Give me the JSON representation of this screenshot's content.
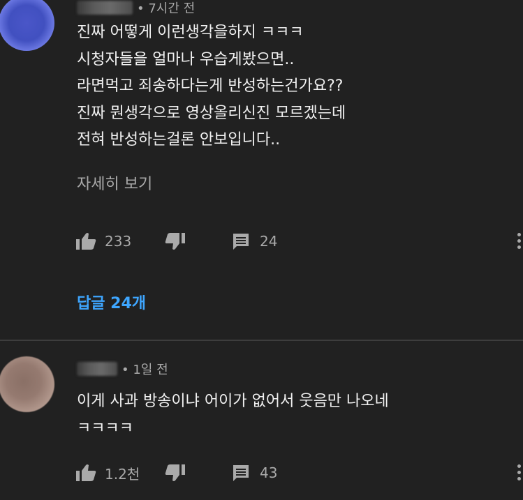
{
  "colors": {
    "background": "#212121",
    "text_primary": "#f1f1f1",
    "text_secondary": "#aaaaaa",
    "link_blue": "#3ea6ff",
    "divider": "#3d3d3d"
  },
  "comments": [
    {
      "time": "• 7시간 전",
      "lines": [
        "진짜 어떻게 이런생각을하지 ㅋㅋㅋ",
        "시청자들을 얼마나 우습게봤으면..",
        "라면먹고 죄송하다는게 반성하는건가요??",
        "진짜 뭔생각으로 영상올리신진 모르겠는데",
        "전혀 반성하는걸론 안보입니다.."
      ],
      "read_more": "자세히 보기",
      "likes": "233",
      "replies_count": "24",
      "replies_link": "답글 24개",
      "icons": {
        "like": "thumb-up-icon",
        "dislike": "thumb-down-icon",
        "reply": "comment-icon",
        "more": "more-vertical-icon"
      }
    },
    {
      "time": "• 1일 전",
      "lines": [
        "이게 사과 방송이냐 어이가 없어서 웃음만 나오네",
        "ㅋㅋㅋㅋ"
      ],
      "likes": "1.2천",
      "replies_count": "43",
      "icons": {
        "like": "thumb-up-icon",
        "dislike": "thumb-down-icon",
        "reply": "comment-icon",
        "more": "more-vertical-icon"
      }
    }
  ]
}
